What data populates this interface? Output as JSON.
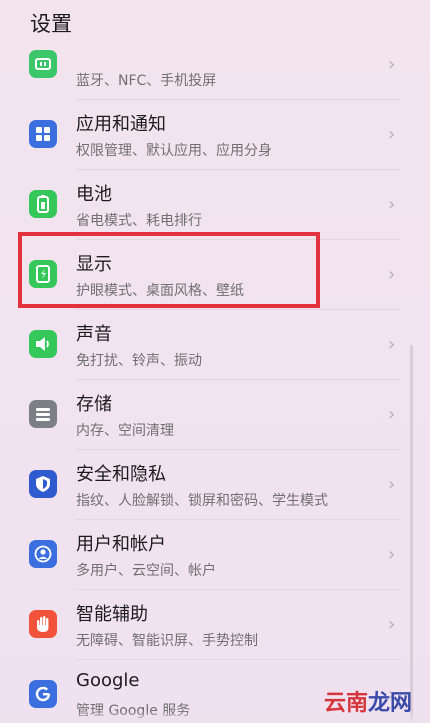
{
  "header": {
    "title": "设置"
  },
  "items": [
    {
      "title": "",
      "subtitle": "蓝牙、NFC、手机投屏",
      "icon": "device-connection-icon",
      "color": "#3cc66a"
    },
    {
      "title": "应用和通知",
      "subtitle": "权限管理、默认应用、应用分身",
      "icon": "apps-grid-icon",
      "color": "#3b6fe0"
    },
    {
      "title": "电池",
      "subtitle": "省电模式、耗电排行",
      "icon": "battery-icon",
      "color": "#36c75b"
    },
    {
      "title": "显示",
      "subtitle": "护眼模式、桌面风格、壁纸",
      "icon": "display-icon",
      "color": "#36c75b"
    },
    {
      "title": "声音",
      "subtitle": "免打扰、铃声、振动",
      "icon": "speaker-icon",
      "color": "#36c75b"
    },
    {
      "title": "存储",
      "subtitle": "内存、空间清理",
      "icon": "storage-icon",
      "color": "#7d7f86"
    },
    {
      "title": "安全和隐私",
      "subtitle": "指纹、人脸解锁、锁屏和密码、学生模式",
      "icon": "shield-icon",
      "color": "#2f5bd0"
    },
    {
      "title": "用户和帐户",
      "subtitle": "多用户、云空间、帐户",
      "icon": "user-account-icon",
      "color": "#3b6fe0"
    },
    {
      "title": "智能辅助",
      "subtitle": "无障碍、智能识屏、手势控制",
      "icon": "hand-icon",
      "color": "#f0533a"
    },
    {
      "title": "Google",
      "subtitle": "管理 Google 服务",
      "icon": "google-icon",
      "color": "#3b6fe0"
    }
  ],
  "watermark": {
    "part1": "云南",
    "part2": "龙网"
  }
}
